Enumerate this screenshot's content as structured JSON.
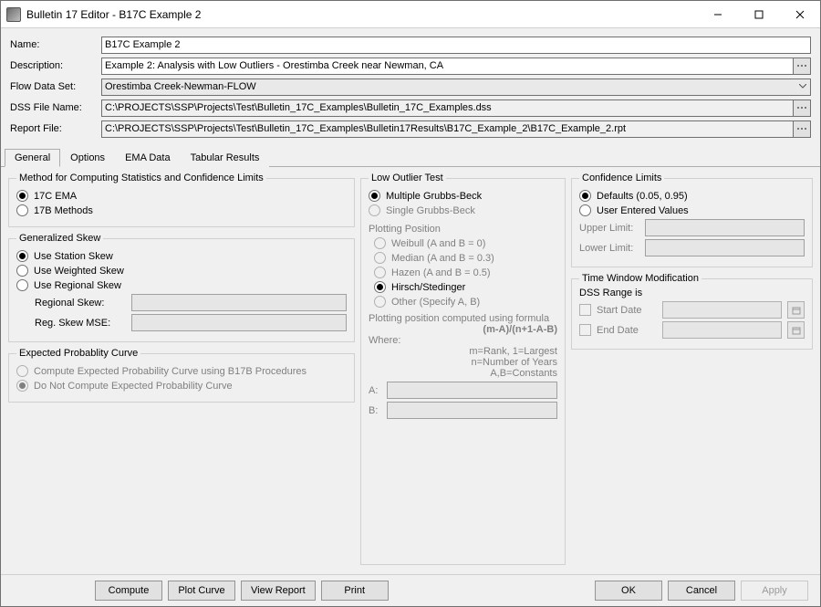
{
  "window": {
    "title": "Bulletin 17 Editor - B17C Example 2"
  },
  "header": {
    "name_label": "Name:",
    "name_value": "B17C Example 2",
    "desc_label": "Description:",
    "desc_value": "Example 2: Analysis with Low Outliers - Orestimba Creek near Newman, CA",
    "flow_label": "Flow Data Set:",
    "flow_value": "Orestimba Creek-Newman-FLOW",
    "dss_label": "DSS File Name:",
    "dss_value": "C:\\PROJECTS\\SSP\\Projects\\Test\\Bulletin_17C_Examples\\Bulletin_17C_Examples.dss",
    "report_label": "Report File:",
    "report_value": "C:\\PROJECTS\\SSP\\Projects\\Test\\Bulletin_17C_Examples\\Bulletin17Results\\B17C_Example_2\\B17C_Example_2.rpt"
  },
  "tabs": {
    "general": "General",
    "options": "Options",
    "ema": "EMA Data",
    "tabular": "Tabular Results"
  },
  "method_group": {
    "legend": "Method for Computing Statistics and Confidence Limits",
    "opt1": "17C EMA",
    "opt2": "17B Methods"
  },
  "skew_group": {
    "legend": "Generalized Skew",
    "station": "Use Station Skew",
    "weighted": "Use Weighted Skew",
    "regional": "Use Regional Skew",
    "regskew_label": "Regional Skew:",
    "regmse_label": "Reg. Skew MSE:"
  },
  "epc_group": {
    "legend": "Expected Probablity Curve",
    "opt1": "Compute Expected Probability Curve using B17B Procedures",
    "opt2": "Do Not Compute Expected Probability Curve"
  },
  "low_group": {
    "legend": "Low Outlier Test",
    "multi": "Multiple Grubbs-Beck",
    "single": "Single Grubbs-Beck"
  },
  "plot_group": {
    "title": "Plotting Position",
    "weibull": "Weibull (A and B = 0)",
    "median": "Median (A and B = 0.3)",
    "hazen": "Hazen (A and B = 0.5)",
    "hirsch": "Hirsch/Stedinger",
    "other": "Other (Specify A, B)",
    "formula_intro": "Plotting position computed using formula",
    "formula": "(m-A)/(n+1-A-B)",
    "where": "Where:",
    "l1": "m=Rank, 1=Largest",
    "l2": "n=Number of Years",
    "l3": "A,B=Constants",
    "a_label": "A:",
    "b_label": "B:"
  },
  "conf_group": {
    "legend": "Confidence Limits",
    "defaults": "Defaults (0.05, 0.95)",
    "user": "User Entered Values",
    "upper": "Upper Limit:",
    "lower": "Lower Limit:"
  },
  "tw_group": {
    "legend": "Time Window Modification",
    "dss_range": "DSS Range is",
    "start": "Start Date",
    "end": "End Date"
  },
  "footer": {
    "compute": "Compute",
    "plot": "Plot Curve",
    "view": "View Report",
    "print": "Print",
    "ok": "OK",
    "cancel": "Cancel",
    "apply": "Apply"
  }
}
